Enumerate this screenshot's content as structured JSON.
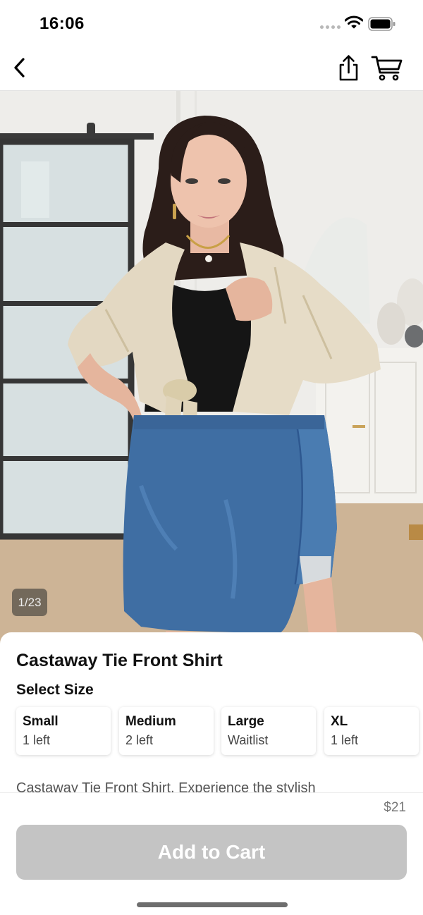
{
  "status_bar": {
    "time": "16:06"
  },
  "product": {
    "title": "Castaway Tie Front Shirt",
    "image_counter": "1/23",
    "select_size_label": "Select Size",
    "sizes": [
      {
        "name": "Small",
        "stock": "1 left"
      },
      {
        "name": "Medium",
        "stock": "2 left"
      },
      {
        "name": "Large",
        "stock": "Waitlist"
      },
      {
        "name": "XL",
        "stock": "1 left"
      }
    ],
    "description": "Castaway Tie Front Shirt. Experience the stylish",
    "price": "$21"
  },
  "actions": {
    "add_to_cart_label": "Add to Cart"
  },
  "icons": [
    "back-arrow-icon",
    "share-icon",
    "cart-icon",
    "wifi-icon",
    "battery-icon"
  ],
  "colors": {
    "button_disabled": "#c4c4c4",
    "skirt_denim": "#3f6ea3",
    "shirt_beige": "#e6dcc6"
  }
}
